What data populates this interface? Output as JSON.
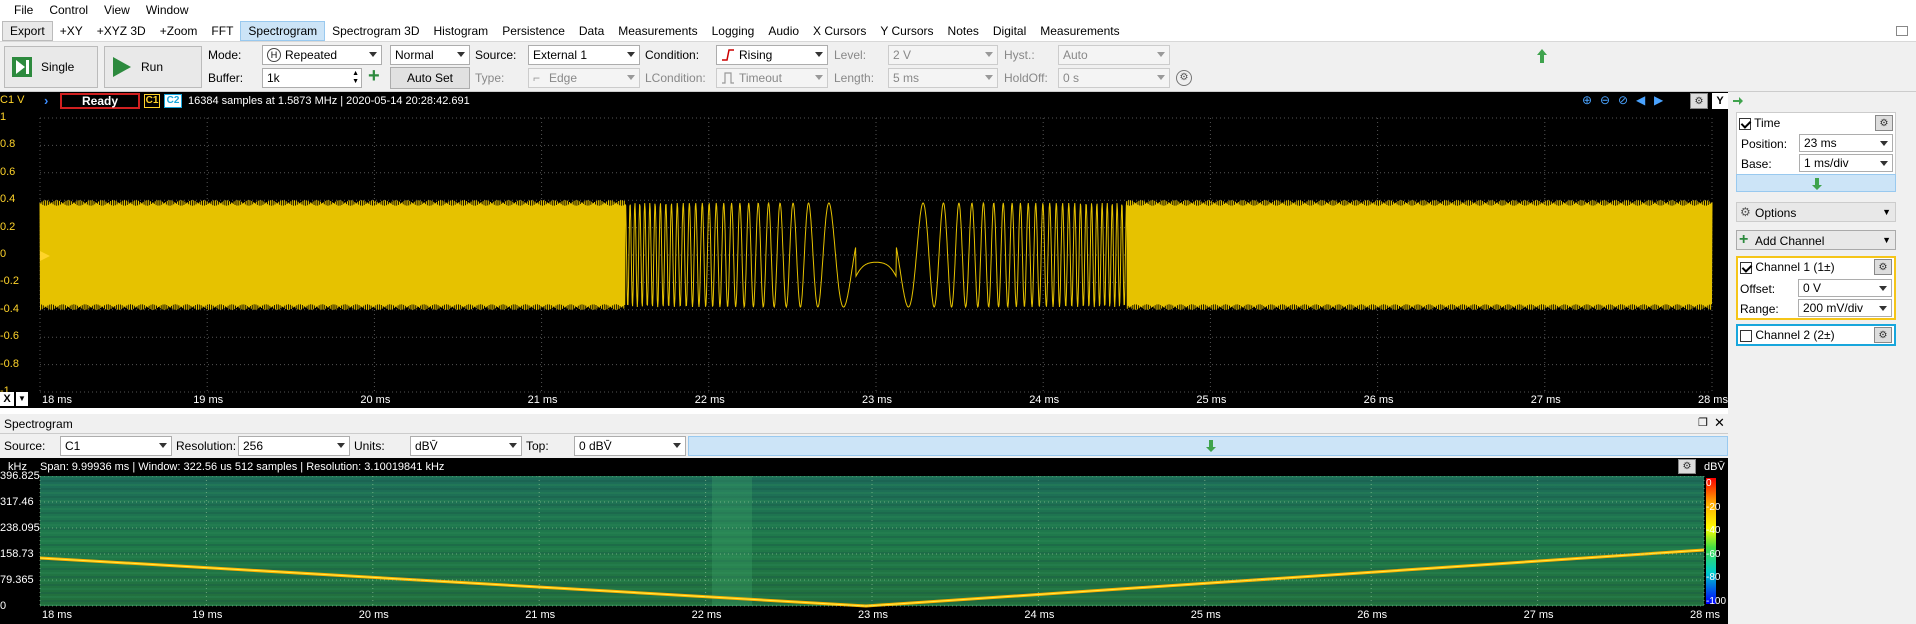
{
  "menu": [
    "File",
    "Control",
    "View",
    "Window"
  ],
  "tabs": [
    "Export",
    "+XY",
    "+XYZ 3D",
    "+Zoom",
    "FFT",
    "Spectrogram",
    "Spectrogram 3D",
    "Histogram",
    "Persistence",
    "Data",
    "Measurements",
    "Logging",
    "Audio",
    "X Cursors",
    "Y Cursors",
    "Notes",
    "Digital",
    "Measurements"
  ],
  "active_tab": "Spectrogram",
  "toolbar": {
    "single": "Single",
    "run": "Run",
    "mode_label": "Mode:",
    "mode_value": "Repeated",
    "buffer_label": "Buffer:",
    "buffer_value": "1k",
    "trigger_type": "Normal",
    "autoset": "Auto Set",
    "source_label": "Source:",
    "source_value": "External 1",
    "type_label": "Type:",
    "type_value": "Edge",
    "condition_label": "Condition:",
    "condition_value": "Rising",
    "lcondition_label": "LCondition:",
    "lcondition_value": "Timeout",
    "level_label": "Level:",
    "level_value": "2 V",
    "length_label": "Length:",
    "length_value": "5 ms",
    "hyst_label": "Hyst.:",
    "hyst_value": "Auto",
    "holdoff_label": "HoldOff:",
    "holdoff_value": "0 s"
  },
  "scope": {
    "channel_unit": "C1 V",
    "status": "Ready",
    "c1": "C1",
    "c2": "C2",
    "info": "16384 samples at 1.5873 MHz | 2020-05-14 20:28:42.691",
    "y_ticks": [
      "1",
      "0.8",
      "0.6",
      "0.4",
      "0.2",
      "0",
      "-0.2",
      "-0.4",
      "-0.6",
      "-0.8",
      "-1"
    ],
    "x_ticks": [
      "18 ms",
      "19 ms",
      "20 ms",
      "21 ms",
      "22 ms",
      "23 ms",
      "24 ms",
      "25 ms",
      "26 ms",
      "27 ms",
      "28 ms"
    ],
    "x_btn": "X",
    "y_btn": "Y",
    "trace_color": "#e6c200"
  },
  "side": {
    "time_label": "Time",
    "position_label": "Position:",
    "position_value": "23 ms",
    "base_label": "Base:",
    "base_value": "1 ms/div",
    "options_label": "Options",
    "add_channel": "Add Channel",
    "ch1_label": "Channel 1 (1±)",
    "offset_label": "Offset:",
    "offset_value": "0 V",
    "range_label": "Range:",
    "range_value": "200 mV/div",
    "ch2_label": "Channel 2 (2±)",
    "ch1_color": "#f5c518",
    "ch2_color": "#18a6dc"
  },
  "spectrogram": {
    "title": "Spectrogram",
    "source_label": "Source:",
    "source_value": "C1",
    "resolution_label": "Resolution:",
    "resolution_value": "256",
    "units_label": "Units:",
    "units_value": "dBV̄",
    "top_label": "Top:",
    "top_value": "0 dBV̄",
    "freq_unit": "kHz",
    "info": "Span: 9.99936 ms | Window: 322.56 us 512 samples | Resolution: 3.10019841 kHz",
    "db_unit": "dBV̄",
    "y_ticks": [
      "396.825",
      "317.46",
      "238.095",
      "158.73",
      "79.365",
      "0"
    ],
    "x_ticks": [
      "18 ms",
      "19 ms",
      "20 ms",
      "21 ms",
      "22 ms",
      "23 ms",
      "24 ms",
      "25 ms",
      "26 ms",
      "27 ms",
      "28 ms"
    ],
    "scale_ticks": [
      "0",
      "-20",
      "-40",
      "-60",
      "-80",
      "-100"
    ]
  }
}
